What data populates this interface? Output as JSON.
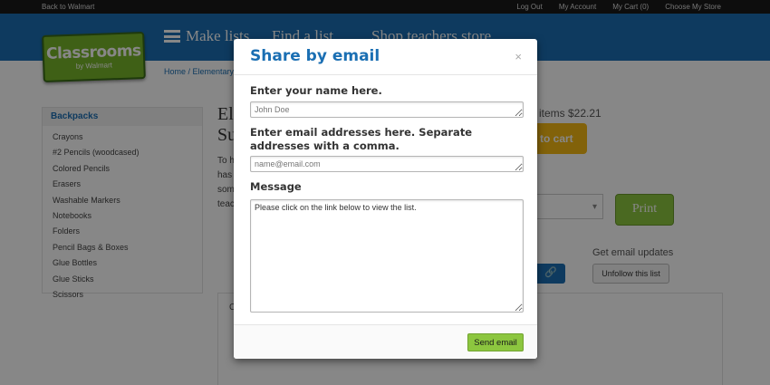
{
  "topbar": {
    "back_label": "Back to Walmart",
    "links": [
      "Log Out",
      "My Account",
      "My Cart (0)",
      "Choose My Store"
    ]
  },
  "header": {
    "logo_title": "Classrooms",
    "logo_sub": "by Walmart",
    "nav": [
      "Make lists",
      "Find a list",
      "Shop teachers store"
    ]
  },
  "breadcrumb": "Home  /  Elementary",
  "sidebar": {
    "title": "Backpacks",
    "items": [
      "Crayons",
      "#2 Pencils (woodcased)",
      "Colored Pencils",
      "Erasers",
      "Washable Markers",
      "Notebooks",
      "Folders",
      "Pencil Bags & Boxes",
      "Glue Bottles",
      "Glue Sticks",
      "Scissors"
    ]
  },
  "content": {
    "title_lines": [
      "El",
      "Su"
    ],
    "desc_lines": [
      "To h",
      "has",
      "som",
      "teac"
    ],
    "items_total": "items $22.21",
    "cart_label": "to cart",
    "print_label": "Print",
    "get_updates": "Get email updates",
    "unfollow_label": "Unfollow this list",
    "panel_text": "C"
  },
  "modal": {
    "title": "Share by email",
    "close_symbol": "×",
    "name_label": "Enter your name here.",
    "name_placeholder": "John Doe",
    "emails_label": "Enter email addresses here. Separate addresses with a comma.",
    "emails_placeholder": "name@email.com",
    "message_label": "Message",
    "message_value": "Please click on the link below to view the list.",
    "send_label": "Send email"
  },
  "colors": {
    "brand_blue": "#1b6fb3",
    "accent_green": "#8cc63f",
    "cart_yellow": "#f5b913",
    "overlay": "rgba(0,0,0,0.47)"
  }
}
